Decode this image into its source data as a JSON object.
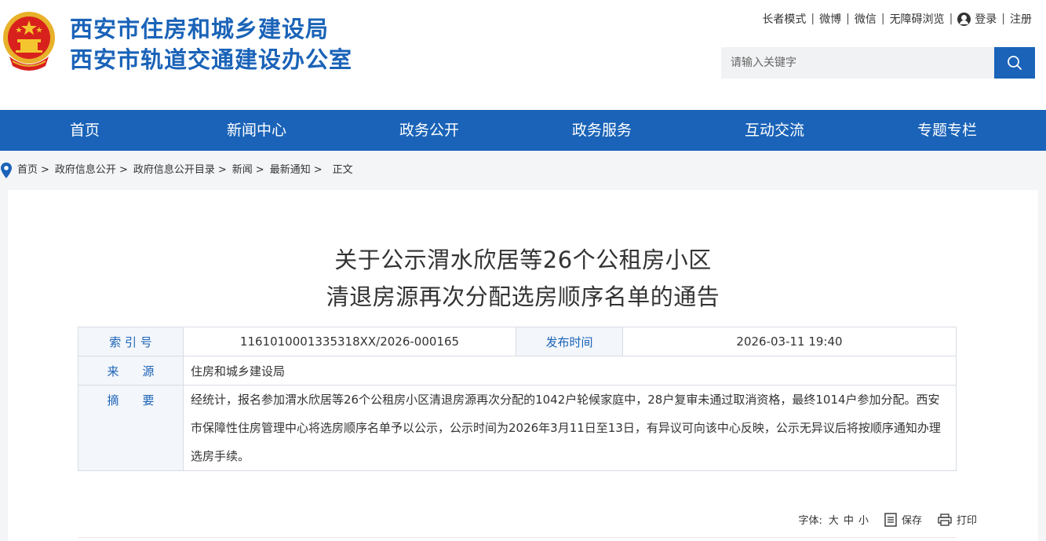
{
  "header": {
    "site_title_1": "西安市住房和城乡建设局",
    "site_title_2": "西安市轨道交通建设办公室",
    "brand_color": "#1a63b8"
  },
  "toplinks": {
    "elder_mode": "长者模式",
    "weibo": "微博",
    "wechat": "微信",
    "accessible": "无障碍浏览",
    "login": "登录",
    "register": "注册",
    "separator": "|"
  },
  "search": {
    "placeholder": "请输入关键字",
    "icon": "search-icon"
  },
  "nav": {
    "items": [
      "首页",
      "新闻中心",
      "政务公开",
      "政务服务",
      "互动交流",
      "专题专栏"
    ]
  },
  "breadcrumb": {
    "items": [
      "首页",
      "政府信息公开",
      "政府信息公开目录",
      "新闻",
      "最新通知",
      "正文"
    ],
    "arrow": ">"
  },
  "article": {
    "title_line1": "关于公示渭水欣居等26个公租房小区",
    "title_line2": "清退房源再次分配选房顺序名单的通告",
    "meta": {
      "index_label": "索 引 号",
      "index_value": "1161010001335318XX/2026-000165",
      "date_label": "发布时间",
      "date_value": "2026-03-11 19:40",
      "source_label": "来　　源",
      "source_value": "住房和城乡建设局",
      "summary_label": "摘　　要",
      "summary_value": "经统计，报名参加渭水欣居等26个公租房小区清退房源再次分配的1042户轮候家庭中，28户复审未通过取消资格，最终1014户参加分配。西安市保障性住房管理中心将选房顺序名单予以公示，公示时间为2026年3月11日至13日，有异议可向该中心反映，公示无异议后将按顺序通知办理选房手续。"
    }
  },
  "tools": {
    "font_label": "字体:",
    "large": "大",
    "medium": "中",
    "small": "小",
    "save": "保存",
    "print": "打印"
  }
}
